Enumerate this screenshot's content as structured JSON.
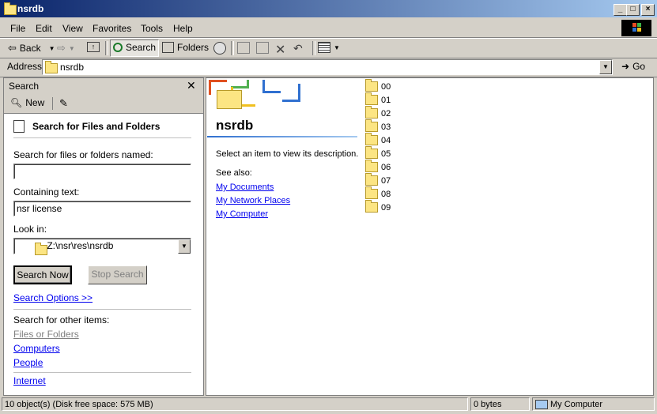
{
  "window": {
    "title": "nsrdb"
  },
  "menu": [
    "File",
    "Edit",
    "View",
    "Favorites",
    "Tools",
    "Help"
  ],
  "toolbar": {
    "back": "Back",
    "search": "Search",
    "folders": "Folders"
  },
  "address": {
    "label": "Address",
    "value": "nsrdb",
    "go": "Go"
  },
  "search_pane": {
    "header": "Search",
    "new_label": "New",
    "heading": "Search for Files and Folders",
    "name_label": "Search for files or folders named:",
    "name_value": "",
    "containing_label": "Containing text:",
    "containing_value": "nsr license",
    "lookin_label": "Look in:",
    "lookin_value": "Z:\\nsr\\res\\nsrdb",
    "search_now": "Search Now",
    "stop_search": "Stop Search",
    "options_link": "Search Options  >>",
    "other_label": "Search for other items:",
    "other_items": [
      "Files or Folders",
      "Computers",
      "People"
    ],
    "internet": "Internet"
  },
  "folder_view": {
    "title": "nsrdb",
    "description": "Select an item to view its description.",
    "see_also": "See also:",
    "links": [
      "My Documents",
      "My Network Places",
      "My Computer"
    ],
    "folders": [
      "00",
      "01",
      "02",
      "03",
      "04",
      "05",
      "06",
      "07",
      "08",
      "09"
    ]
  },
  "status": {
    "objects": "10 object(s) (Disk free space: 575 MB)",
    "size": "0 bytes",
    "zone": "My Computer"
  }
}
